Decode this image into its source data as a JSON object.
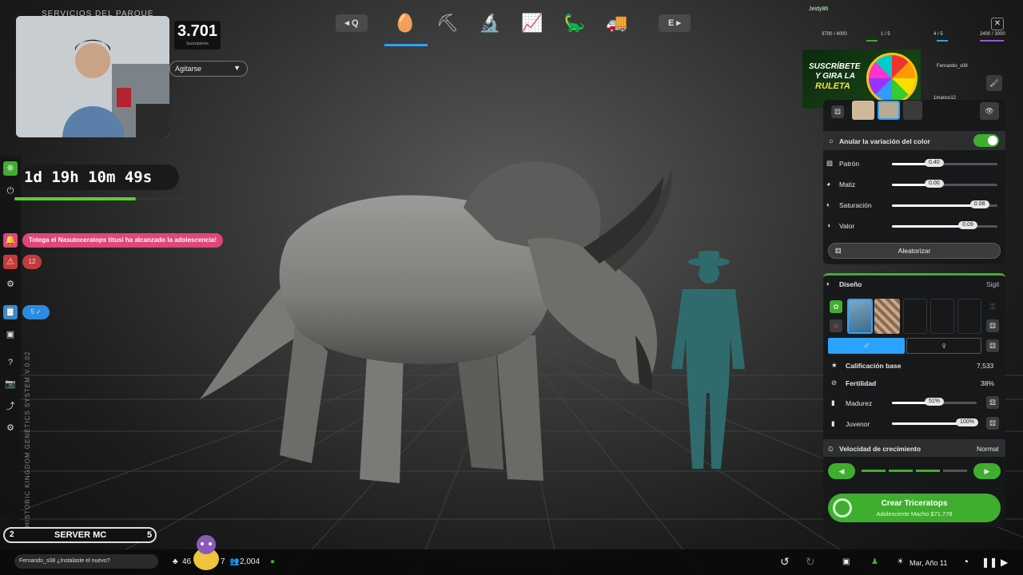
{
  "park": {
    "title": "SERVICIOS DEL PARQUE"
  },
  "stream": {
    "subscribers": "3.701",
    "subscribers_label": "Suscriptores",
    "dropdown": "Agitarse"
  },
  "toolbar": {
    "left_key": "◂ Q",
    "right_key": "E ▸",
    "tabs": [
      "egg-icon",
      "excavation-icon",
      "microscope-icon",
      "chart-icon",
      "dino-list-icon",
      "transport-icon"
    ]
  },
  "top_right": {
    "user": "Jeidy86",
    "stats": [
      "3700 / 4000",
      "1 / 5",
      "4 / 5",
      "2400 / 3000"
    ],
    "chat_users": [
      "Fernando_s08",
      "1manco12"
    ]
  },
  "left": {
    "timer": "1d 19h 10m 49s",
    "timer_progress": 0.69,
    "notification": "Totega el Nasutoceratops titusi ha alcanzado la adolescencia!",
    "alerts_count": "12",
    "tasks_count": "5 ✓",
    "vertical_text": "HISTORIC KINGDOM GENETICS SYSTEM V.0.02"
  },
  "promo": {
    "line1": "SUSCRÍBETE",
    "line2": "Y GIRA LA",
    "line3": "RULETA"
  },
  "color_panel": {
    "override_label": "Anular la variación del color",
    "override_on": true,
    "sliders": [
      {
        "label": "Patrón",
        "value": "0.40",
        "fraction": 0.4,
        "icon": "pattern-icon"
      },
      {
        "label": "Matiz",
        "value": "0.00",
        "fraction": 0.4,
        "icon": "hue-icon"
      },
      {
        "label": "Saturación",
        "value": "0.08",
        "fraction": 0.83,
        "icon": "saturation-icon"
      },
      {
        "label": "Valor",
        "value": "0.09",
        "fraction": 0.72,
        "icon": "value-icon"
      }
    ],
    "randomize_label": "Aleatorizar"
  },
  "design_panel": {
    "title": "Diseño",
    "name": "Sigil",
    "base_rating_label": "Calificación base",
    "base_rating_value": "7,533",
    "fertility_label": "Fertilidad",
    "fertility_value": "38%",
    "maturity_label": "Madurez",
    "maturity_value": "51%",
    "maturity_fraction": 0.51,
    "juvenile_label": "Juvenor",
    "juvenile_value": "100%",
    "juvenile_fraction": 1.0,
    "growth_label": "Velocidad de crecimiento",
    "growth_value": "Normal",
    "create_label": "Crear Triceratops",
    "create_sub": "Adolescente Macho $71,778"
  },
  "bottom": {
    "server_left": "2",
    "server_name": "SERVER MC",
    "server_right": "5",
    "chat_text": "Fernando_s08 ¿Instalaste el nuevo?",
    "dino_count": "46",
    "dino_count2": "7",
    "guests": "2,004",
    "date": "Mar, Año 11"
  },
  "colors": {
    "accent_green": "#3fae2e",
    "accent_blue": "#2aa3ff",
    "notif_pink": "#e0457b"
  }
}
